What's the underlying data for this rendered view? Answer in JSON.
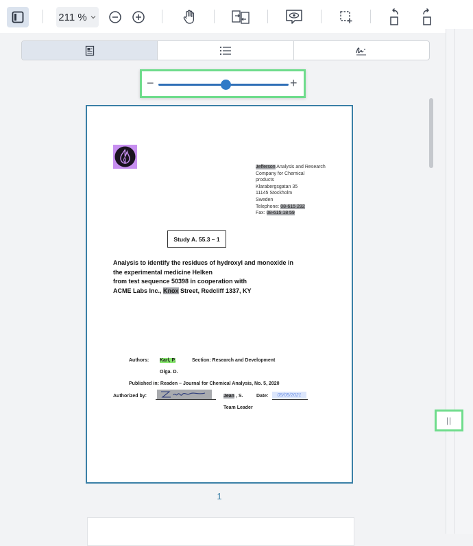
{
  "toolbar": {
    "zoom_label": "211 %",
    "icons": [
      "sidebar-toggle-icon",
      "chevron-down-icon",
      "zoom-out-icon",
      "zoom-in-icon",
      "hand-tool-icon",
      "compare-icon",
      "preview-icon",
      "selection-icon",
      "rotate-left-icon",
      "rotate-right-icon"
    ]
  },
  "sidebar": {
    "tabs": [
      {
        "name": "thumbnails",
        "icon": "thumbnails-icon",
        "active": true
      },
      {
        "name": "outline",
        "icon": "outline-list-icon",
        "active": false
      },
      {
        "name": "signatures",
        "icon": "signature-icon",
        "active": false
      }
    ],
    "slider": {
      "minus": "−",
      "plus": "+",
      "value_fraction": 0.52
    }
  },
  "document": {
    "address": {
      "line1_highlight": "Jefferson",
      "line1_rest": " Analysis and Research",
      "line2": "Company for Chemical",
      "line3": "products",
      "line4": "Klarabergsgatan 35",
      "line5": "11145 Stockholm",
      "line6": "Sweden",
      "tel_label": "Telephone: ",
      "tel_value": "08-615 292",
      "fax_label": "Fax: ",
      "fax_value": "08-615 18 59"
    },
    "study": "Study A. 55.3 – 1",
    "title": {
      "line1": "Analysis to identify the residues of hydroxyl and monoxide in",
      "line2": "the experimental medicine Helken",
      "line3": "from test sequence 50398 in cooperation with",
      "line4_pre": "ACME Labs Inc., ",
      "line4_hl": "Knox",
      "line4_post": " Street, Redcliff 1337, KY"
    },
    "authors_label": "Authors:",
    "author1": "Karl, P.",
    "section": "Section: Research and Development",
    "author2": "Olga. D.",
    "published": "Published in: Readen – Journal for Chemical Analysis, No. 5, 2020",
    "authorized_label": "Authorized by:",
    "signer_hl": "Jean",
    "signer_rest": ", S.",
    "date_label": "Date:",
    "date_value": "05/05/2021",
    "team_leader": "Team Leader"
  },
  "page_number": "1",
  "colors": {
    "accent": "#2f7ac7",
    "highlight_green": "#84e66a",
    "highlight_gray": "#a6a8ac",
    "focus_green": "#6fdc8c"
  }
}
